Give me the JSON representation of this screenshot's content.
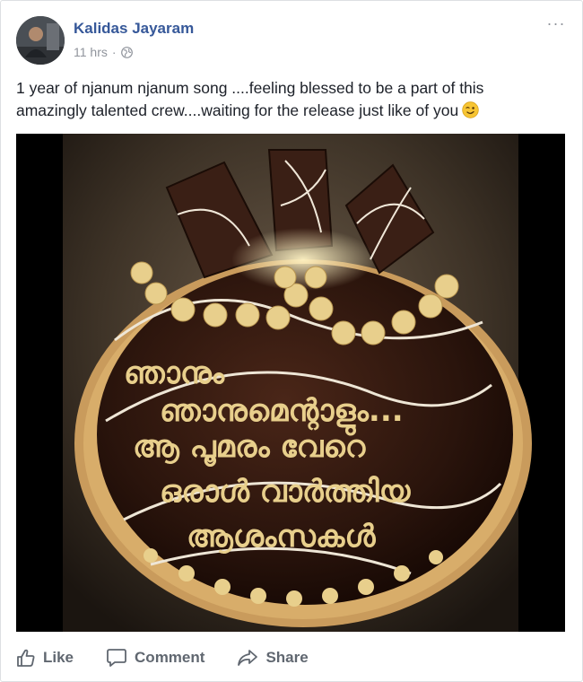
{
  "post": {
    "author": "Kalidas Jayaram",
    "time": "11 hrs",
    "separator": "·",
    "privacy_icon": "globe-icon",
    "more_icon": "ellipsis-icon",
    "more_label": "···",
    "text_line1": "1 year of njanum njanum song ....feeling blessed to be a part of this",
    "text_line2": "amazingly talented crew....waiting for the release just like of you",
    "emoji": "wink-emoji",
    "photo": {
      "description_icon": "cake-photo",
      "cake_text_lines": [
        "ഞാനും",
        "ഞാനുമെന്റാളും...",
        "ആ പൂമരം വേറെ",
        "ഒരാൾ വാർത്തിയ",
        "ആശംസകൾ"
      ]
    }
  },
  "actions": {
    "like": "Like",
    "comment": "Comment",
    "share": "Share"
  },
  "colors": {
    "author_link": "#365899",
    "meta_text": "#90949c",
    "action_text": "#606770",
    "cake_chocolate": "#2a140c",
    "cake_cream": "#e8cf8c"
  }
}
